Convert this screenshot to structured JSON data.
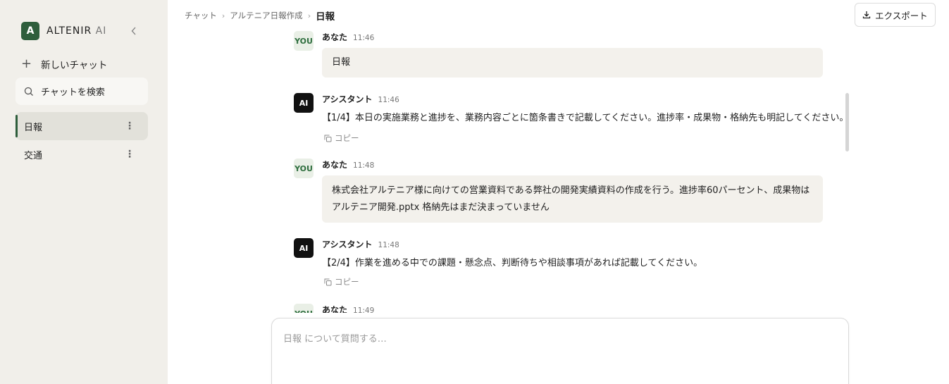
{
  "sidebar": {
    "logo_letter": "A",
    "brand_name": "ALTENIR",
    "brand_suffix": "AI",
    "new_chat_label": "新しいチャット",
    "search_label": "チャットを検索",
    "items": [
      {
        "label": "日報",
        "active": true
      },
      {
        "label": "交通",
        "active": false
      }
    ]
  },
  "header": {
    "breadcrumb": [
      "チャット",
      "アルテニア日報作成",
      "日報"
    ],
    "separator": "›",
    "export_label": "エクスポート"
  },
  "messages": [
    {
      "role": "you",
      "avatar": "YOU",
      "author": "あなた",
      "time": "11:46",
      "text": "日報"
    },
    {
      "role": "ai",
      "avatar": "AI",
      "author": "アシスタント",
      "time": "11:46",
      "text": "【1/4】本日の実施業務と進捗を、業務内容ごとに箇条書きで記載してください。進捗率・成果物・格納先も明記してください。",
      "copy_label": "コピー"
    },
    {
      "role": "you",
      "avatar": "YOU",
      "author": "あなた",
      "time": "11:48",
      "text": "株式会社アルテニア様に向けての営業資料である弊社の開発実績資料の作成を行う。進捗率60パーセント、成果物はアルテニア開発.pptx 格納先はまだ決まっていません"
    },
    {
      "role": "ai",
      "avatar": "AI",
      "author": "アシスタント",
      "time": "11:48",
      "text": "【2/4】作業を進める中での課題・懸念点、判断待ちや相談事項があれば記載してください。",
      "copy_label": "コピー"
    },
    {
      "role": "you",
      "avatar": "YOU",
      "author": "あなた",
      "time": "11:49",
      "text": ""
    }
  ],
  "composer": {
    "placeholder": "日報 について質問する…",
    "value": ""
  },
  "colors": {
    "brand": "#2e5e3c",
    "sidebar_bg": "#f1efea",
    "bubble_bg": "#f3f1ec"
  },
  "icons": [
    "plus-icon",
    "search-icon",
    "chevron-left-icon",
    "more-vertical-icon",
    "download-icon",
    "copy-icon"
  ]
}
